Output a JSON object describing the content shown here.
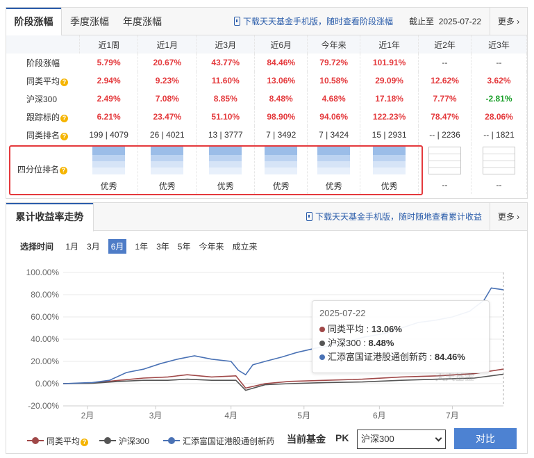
{
  "perf": {
    "tabs": [
      "阶段涨幅",
      "季度涨幅",
      "年度涨幅"
    ],
    "download": "下载天天基金手机版，随时查看阶段涨幅",
    "asof_label": "截止至",
    "asof_date": "2025-07-22",
    "more": "更多",
    "cols": [
      "近1周",
      "近1月",
      "近3月",
      "近6月",
      "今年来",
      "近1年",
      "近2年",
      "近3年"
    ],
    "rows": [
      {
        "label": "阶段涨幅",
        "help": false,
        "cells": [
          {
            "v": "5.79%",
            "c": "red"
          },
          {
            "v": "20.67%",
            "c": "red"
          },
          {
            "v": "43.77%",
            "c": "red"
          },
          {
            "v": "84.46%",
            "c": "red"
          },
          {
            "v": "79.72%",
            "c": "red"
          },
          {
            "v": "101.91%",
            "c": "red"
          },
          {
            "v": "--",
            "c": "plain"
          },
          {
            "v": "--",
            "c": "plain"
          }
        ]
      },
      {
        "label": "同类平均",
        "help": true,
        "cells": [
          {
            "v": "2.94%",
            "c": "red"
          },
          {
            "v": "9.23%",
            "c": "red"
          },
          {
            "v": "11.60%",
            "c": "red"
          },
          {
            "v": "13.06%",
            "c": "red"
          },
          {
            "v": "10.58%",
            "c": "red"
          },
          {
            "v": "29.09%",
            "c": "red"
          },
          {
            "v": "12.62%",
            "c": "red"
          },
          {
            "v": "3.62%",
            "c": "red"
          }
        ]
      },
      {
        "label": "沪深300",
        "help": false,
        "cells": [
          {
            "v": "2.49%",
            "c": "red"
          },
          {
            "v": "7.08%",
            "c": "red"
          },
          {
            "v": "8.85%",
            "c": "red"
          },
          {
            "v": "8.48%",
            "c": "red"
          },
          {
            "v": "4.68%",
            "c": "red"
          },
          {
            "v": "17.18%",
            "c": "red"
          },
          {
            "v": "7.77%",
            "c": "red"
          },
          {
            "v": "-2.81%",
            "c": "green"
          }
        ]
      },
      {
        "label": "跟踪标的",
        "help": true,
        "cells": [
          {
            "v": "6.21%",
            "c": "red"
          },
          {
            "v": "23.47%",
            "c": "red"
          },
          {
            "v": "51.10%",
            "c": "red"
          },
          {
            "v": "98.90%",
            "c": "red"
          },
          {
            "v": "94.06%",
            "c": "red"
          },
          {
            "v": "122.23%",
            "c": "red"
          },
          {
            "v": "78.47%",
            "c": "red"
          },
          {
            "v": "28.06%",
            "c": "red"
          }
        ]
      },
      {
        "label": "同类排名",
        "help": true,
        "cells": [
          {
            "v": "199 | 4079",
            "c": "plain"
          },
          {
            "v": "26 | 4021",
            "c": "plain"
          },
          {
            "v": "13 | 3777",
            "c": "plain"
          },
          {
            "v": "7 | 3492",
            "c": "plain"
          },
          {
            "v": "7 | 3424",
            "c": "plain"
          },
          {
            "v": "15 | 2931",
            "c": "plain"
          },
          {
            "v": "-- | 2236",
            "c": "plain"
          },
          {
            "v": "-- | 1821",
            "c": "plain"
          }
        ]
      }
    ],
    "quartile_label": "四分位排名",
    "quartiles": [
      "优秀",
      "优秀",
      "优秀",
      "优秀",
      "优秀",
      "优秀",
      "--",
      "--"
    ]
  },
  "trend": {
    "title": "累计收益率走势",
    "download": "下载天天基金手机版，随时随地查看累计收益",
    "more": "更多",
    "range_label": "选择时间",
    "ranges": [
      "1月",
      "3月",
      "6月",
      "1年",
      "3年",
      "5年",
      "今年来",
      "成立来"
    ],
    "selected_range": "6月",
    "tooltip": {
      "date": "2025-07-22",
      "rows": [
        {
          "name": "同类平均",
          "value": "13.06%",
          "color": "#a04848"
        },
        {
          "name": "沪深300",
          "value": "8.48%",
          "color": "#555555"
        },
        {
          "name": "汇添富国证港股通创新药",
          "value": "84.46%",
          "color": "#4a72b5"
        }
      ]
    },
    "watermark": "天天基金",
    "legend": [
      {
        "name": "同类平均",
        "color": "#a04848",
        "help": true
      },
      {
        "name": "沪深300",
        "color": "#555555",
        "help": false
      },
      {
        "name": "汇添富国证港股通创新药",
        "color": "#4a72b5",
        "help": false
      }
    ],
    "pk_label": "当前基金",
    "pk": "PK",
    "pk_select": "沪深300",
    "compare_button": "对比"
  },
  "chart_data": {
    "type": "line",
    "y_tick_labels": [
      "100.00%",
      "80.00%",
      "60.00%",
      "40.00%",
      "20.00%",
      "0.00%",
      "-20.00%"
    ],
    "ylim": [
      -20,
      100
    ],
    "x_tick_labels": [
      "2月",
      "3月",
      "4月",
      "5月",
      "6月",
      "7月"
    ],
    "x_range": [
      "2025-01-22",
      "2025-07-22"
    ],
    "series": [
      {
        "name": "同类平均",
        "color": "#a04848",
        "points": [
          [
            "2025-01-22",
            0
          ],
          [
            "2025-02-03",
            0.5
          ],
          [
            "2025-02-14",
            3
          ],
          [
            "2025-02-24",
            5
          ],
          [
            "2025-03-06",
            6
          ],
          [
            "2025-03-14",
            8
          ],
          [
            "2025-03-24",
            6
          ],
          [
            "2025-04-03",
            7
          ],
          [
            "2025-04-07",
            -4
          ],
          [
            "2025-04-15",
            0
          ],
          [
            "2025-04-25",
            2
          ],
          [
            "2025-05-10",
            3
          ],
          [
            "2025-05-25",
            4
          ],
          [
            "2025-06-10",
            6
          ],
          [
            "2025-06-25",
            7
          ],
          [
            "2025-07-10",
            9
          ],
          [
            "2025-07-22",
            13.06
          ]
        ]
      },
      {
        "name": "沪深300",
        "color": "#555555",
        "points": [
          [
            "2025-01-22",
            0
          ],
          [
            "2025-02-03",
            0.3
          ],
          [
            "2025-02-14",
            2
          ],
          [
            "2025-02-24",
            3
          ],
          [
            "2025-03-06",
            3
          ],
          [
            "2025-03-14",
            4
          ],
          [
            "2025-03-24",
            3
          ],
          [
            "2025-04-03",
            3
          ],
          [
            "2025-04-07",
            -6
          ],
          [
            "2025-04-15",
            -1
          ],
          [
            "2025-04-25",
            0
          ],
          [
            "2025-05-10",
            1
          ],
          [
            "2025-05-25",
            1.5
          ],
          [
            "2025-06-10",
            3
          ],
          [
            "2025-06-25",
            4
          ],
          [
            "2025-07-10",
            5
          ],
          [
            "2025-07-22",
            8.48
          ]
        ]
      },
      {
        "name": "汇添富国证港股通创新药",
        "color": "#4a72b5",
        "points": [
          [
            "2025-01-22",
            0
          ],
          [
            "2025-02-03",
            1
          ],
          [
            "2025-02-10",
            3
          ],
          [
            "2025-02-17",
            10
          ],
          [
            "2025-02-24",
            13
          ],
          [
            "2025-03-03",
            18
          ],
          [
            "2025-03-10",
            22
          ],
          [
            "2025-03-17",
            25
          ],
          [
            "2025-03-24",
            22
          ],
          [
            "2025-04-01",
            20
          ],
          [
            "2025-04-04",
            12
          ],
          [
            "2025-04-07",
            8
          ],
          [
            "2025-04-10",
            17
          ],
          [
            "2025-04-15",
            20
          ],
          [
            "2025-04-22",
            24
          ],
          [
            "2025-04-28",
            28
          ],
          [
            "2025-05-06",
            32
          ],
          [
            "2025-05-12",
            34
          ],
          [
            "2025-05-19",
            38
          ],
          [
            "2025-05-26",
            42
          ],
          [
            "2025-06-03",
            45
          ],
          [
            "2025-06-10",
            50
          ],
          [
            "2025-06-17",
            55
          ],
          [
            "2025-06-24",
            57
          ],
          [
            "2025-07-01",
            60
          ],
          [
            "2025-07-08",
            65
          ],
          [
            "2025-07-14",
            75
          ],
          [
            "2025-07-17",
            86
          ],
          [
            "2025-07-22",
            84.46
          ]
        ]
      }
    ]
  }
}
